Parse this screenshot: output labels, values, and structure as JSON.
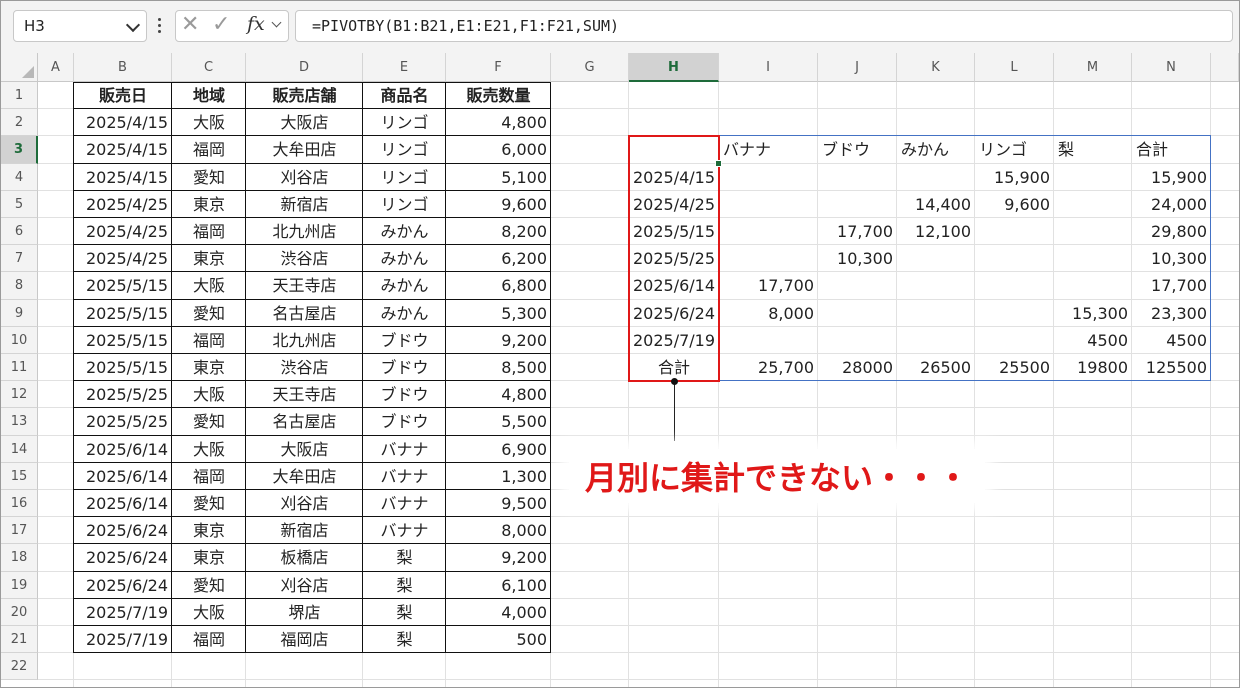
{
  "namebox": {
    "value": "H3"
  },
  "formula": {
    "fx_label": "fx",
    "text": "=PIVOTBY(B1:B21,E1:E21,F1:F21,SUM)"
  },
  "columns": [
    "A",
    "B",
    "C",
    "D",
    "E",
    "F",
    "G",
    "H",
    "I",
    "J",
    "K",
    "L",
    "M",
    "N"
  ],
  "rows": [
    "1",
    "2",
    "3",
    "4",
    "5",
    "6",
    "7",
    "8",
    "9",
    "10",
    "11",
    "12",
    "13",
    "14",
    "15",
    "16",
    "17",
    "18",
    "19",
    "20",
    "21",
    "22"
  ],
  "selected_column": "H",
  "selected_row": "3",
  "source_table": {
    "headers": [
      "販売日",
      "地域",
      "販売店舗",
      "商品名",
      "販売数量"
    ],
    "rows": [
      [
        "2025/4/15",
        "大阪",
        "大阪店",
        "リンゴ",
        "4,800"
      ],
      [
        "2025/4/15",
        "福岡",
        "大牟田店",
        "リンゴ",
        "6,000"
      ],
      [
        "2025/4/15",
        "愛知",
        "刈谷店",
        "リンゴ",
        "5,100"
      ],
      [
        "2025/4/25",
        "東京",
        "新宿店",
        "リンゴ",
        "9,600"
      ],
      [
        "2025/4/25",
        "福岡",
        "北九州店",
        "みかん",
        "8,200"
      ],
      [
        "2025/4/25",
        "東京",
        "渋谷店",
        "みかん",
        "6,200"
      ],
      [
        "2025/5/15",
        "大阪",
        "天王寺店",
        "みかん",
        "6,800"
      ],
      [
        "2025/5/15",
        "愛知",
        "名古屋店",
        "みかん",
        "5,300"
      ],
      [
        "2025/5/15",
        "福岡",
        "北九州店",
        "ブドウ",
        "9,200"
      ],
      [
        "2025/5/15",
        "東京",
        "渋谷店",
        "ブドウ",
        "8,500"
      ],
      [
        "2025/5/25",
        "大阪",
        "天王寺店",
        "ブドウ",
        "4,800"
      ],
      [
        "2025/5/25",
        "愛知",
        "名古屋店",
        "ブドウ",
        "5,500"
      ],
      [
        "2025/6/14",
        "大阪",
        "大阪店",
        "バナナ",
        "6,900"
      ],
      [
        "2025/6/14",
        "福岡",
        "大牟田店",
        "バナナ",
        "1,300"
      ],
      [
        "2025/6/14",
        "愛知",
        "刈谷店",
        "バナナ",
        "9,500"
      ],
      [
        "2025/6/24",
        "東京",
        "新宿店",
        "バナナ",
        "8,000"
      ],
      [
        "2025/6/24",
        "東京",
        "板橋店",
        "梨",
        "9,200"
      ],
      [
        "2025/6/24",
        "愛知",
        "刈谷店",
        "梨",
        "6,100"
      ],
      [
        "2025/7/19",
        "大阪",
        "堺店",
        "梨",
        "4,000"
      ],
      [
        "2025/7/19",
        "福岡",
        "福岡店",
        "梨",
        "500"
      ]
    ]
  },
  "pivot": {
    "col_headers": [
      "バナナ",
      "ブドウ",
      "みかん",
      "リンゴ",
      "梨",
      "合計"
    ],
    "rows": [
      [
        "2025/4/15",
        "",
        "",
        "",
        "15,900",
        "",
        "15,900"
      ],
      [
        "2025/4/25",
        "",
        "",
        "14,400",
        "9,600",
        "",
        "24,000"
      ],
      [
        "2025/5/15",
        "",
        "17,700",
        "12,100",
        "",
        "",
        "29,800"
      ],
      [
        "2025/5/25",
        "",
        "10,300",
        "",
        "",
        "",
        "10,300"
      ],
      [
        "2025/6/14",
        "17,700",
        "",
        "",
        "",
        "",
        "17,700"
      ],
      [
        "2025/6/24",
        "8,000",
        "",
        "",
        "",
        "15,300",
        "23,300"
      ],
      [
        "2025/7/19",
        "",
        "",
        "",
        "",
        "4500",
        "4500"
      ],
      [
        "合計",
        "25,700",
        "28000",
        "26500",
        "25500",
        "19800",
        "125500"
      ]
    ]
  },
  "callout": {
    "text": "月別に集計できない・・・",
    "color": "#e01818"
  }
}
